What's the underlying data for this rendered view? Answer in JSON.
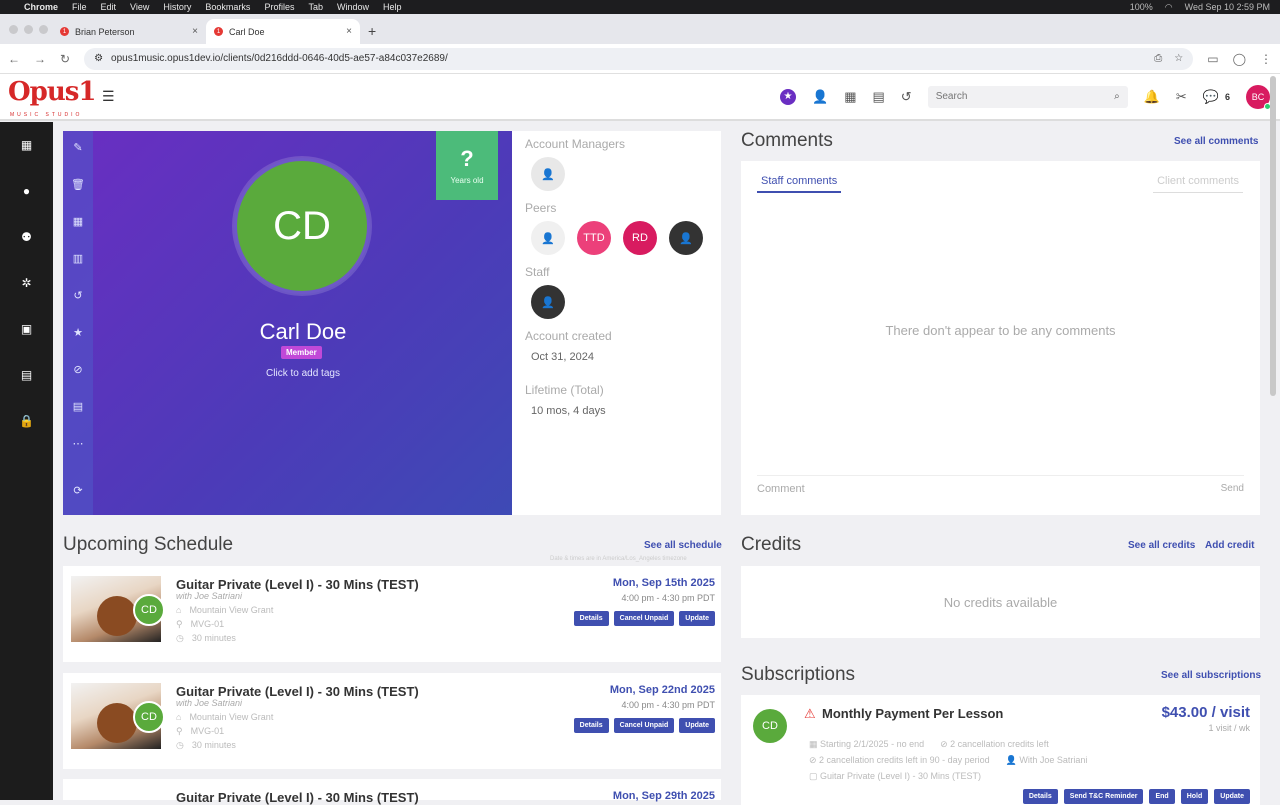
{
  "menubar": {
    "app": "Chrome",
    "items": [
      "File",
      "Edit",
      "View",
      "History",
      "Bookmarks",
      "Profiles",
      "Tab",
      "Window",
      "Help"
    ],
    "battery": "100%",
    "clock": "Wed Sep 10  2:59 PM"
  },
  "tabs": [
    {
      "label": "Brian Peterson"
    },
    {
      "label": "Carl Doe"
    }
  ],
  "url": "opus1music.opus1dev.io/clients/0d216ddd-0646-40d5-ae57-a84c037e2689/",
  "header": {
    "logo": "Opus1",
    "logo_sub": "MUSIC STUDIO",
    "search_placeholder": "Search",
    "message_count": "6",
    "user_initials": "BC"
  },
  "profile": {
    "initials": "CD",
    "name": "Carl Doe",
    "badge": "Member",
    "tags": "Click to add tags",
    "years_symbol": "?",
    "years_label": "Years old"
  },
  "info": {
    "account_managers_label": "Account Managers",
    "peers_label": "Peers",
    "peers": [
      {
        "initials": "",
        "color": "#ffffff"
      },
      {
        "initials": "TTD",
        "color": "#ec407a"
      },
      {
        "initials": "RD",
        "color": "#d81b60"
      },
      {
        "initials": "",
        "color": "#333333"
      }
    ],
    "staff_label": "Staff",
    "account_created_label": "Account created",
    "account_created": "Oct 31, 2024",
    "lifetime_label": "Lifetime (Total)",
    "lifetime": "10 mos, 4 days"
  },
  "comments": {
    "title": "Comments",
    "see_all": "See all comments",
    "tab_staff": "Staff comments",
    "tab_client": "Client comments",
    "empty": "There don't appear to be any comments",
    "placeholder": "Comment",
    "send": "Send"
  },
  "schedule": {
    "title": "Upcoming Schedule",
    "see_all": "See all schedule",
    "tz_note": "Date & times are in America/Los_Angeles timezone",
    "lessons": [
      {
        "title": "Guitar Private (Level I) - 30 Mins (TEST)",
        "with": "with Joe Satriani",
        "location": "Mountain View Grant",
        "room": "MVG-01",
        "duration": "30 minutes",
        "date": "Mon, Sep 15th 2025",
        "time": "4:00 pm - 4:30 pm PDT",
        "initials": "CD"
      },
      {
        "title": "Guitar Private (Level I) - 30 Mins (TEST)",
        "with": "with Joe Satriani",
        "location": "Mountain View Grant",
        "room": "MVG-01",
        "duration": "30 minutes",
        "date": "Mon, Sep 22nd 2025",
        "time": "4:00 pm - 4:30 pm PDT",
        "initials": "CD"
      },
      {
        "title": "Guitar Private (Level I) - 30 Mins (TEST)",
        "date": "Mon, Sep 29th 2025"
      }
    ],
    "btn_details": "Details",
    "btn_cancel": "Cancel Unpaid",
    "btn_update": "Update"
  },
  "credits": {
    "title": "Credits",
    "see_all": "See all credits",
    "add": "Add credit",
    "empty": "No credits available"
  },
  "subscriptions": {
    "title": "Subscriptions",
    "see_all": "See all subscriptions",
    "item": {
      "initials": "CD",
      "name": "Monthly Payment Per Lesson",
      "price": "$43.00 / visit",
      "per": "1 visit / wk",
      "starting": "Starting 2/1/2025 - no end",
      "cancel_credits": "2 cancellation credits left",
      "cancel_period": "2 cancellation credits left in 90 - day period",
      "teacher": "With Joe Satriani",
      "lesson": "Guitar Private (Level I) - 30 Mins (TEST)"
    },
    "btns": [
      "Details",
      "Send T&C Reminder",
      "End",
      "Hold",
      "Update"
    ]
  }
}
